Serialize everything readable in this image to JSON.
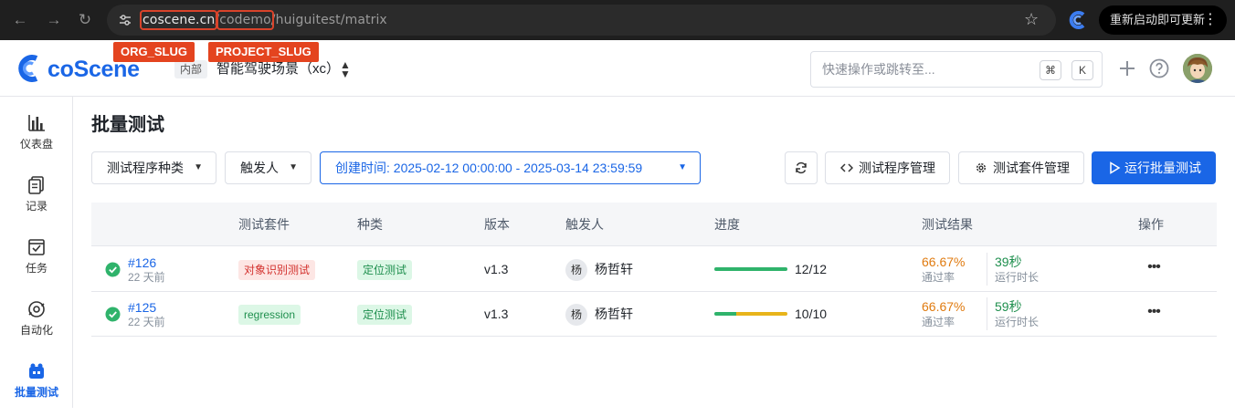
{
  "browser": {
    "url_host": "coscene.cn",
    "url_slash1": "/",
    "url_project": "codemo",
    "url_rest": "/huiguitest/matrix",
    "update_label": "重新启动即可更新",
    "annotations": {
      "org": "ORG_SLUG",
      "project": "PROJECT_SLUG"
    }
  },
  "header": {
    "brand": "coScene",
    "internal_tag": "内部",
    "project_name": "智能驾驶场景（xc）",
    "search_placeholder": "快速操作或跳转至...",
    "kbd_cmd": "⌘",
    "kbd_k": "K"
  },
  "sidebar": {
    "items": [
      {
        "label": "仪表盘",
        "icon": "chart-bar-icon"
      },
      {
        "label": "记录",
        "icon": "records-icon"
      },
      {
        "label": "任务",
        "icon": "task-icon"
      },
      {
        "label": "自动化",
        "icon": "automation-icon"
      },
      {
        "label": "批量测试",
        "icon": "batch-test-icon",
        "active": true
      }
    ]
  },
  "page": {
    "title": "批量测试",
    "filters": {
      "program_type": "测试程序种类",
      "trigger": "触发人",
      "date_range": "创建时间: 2025-02-12 00:00:00 - 2025-03-14 23:59:59"
    },
    "actions": {
      "program_manage": "测试程序管理",
      "suite_manage": "测试套件管理",
      "run": "运行批量测试"
    }
  },
  "table": {
    "columns": [
      "测试套件",
      "种类",
      "版本",
      "触发人",
      "进度",
      "测试结果",
      "操作"
    ],
    "rows": [
      {
        "id": "#126",
        "time": "22 天前",
        "suite": "对象识别测试",
        "suite_color": "red",
        "type": "定位测试",
        "version": "v1.3",
        "user_initial": "杨",
        "user": "杨哲轩",
        "progress": "12/12",
        "progress_segments": [
          {
            "color": "#2fb36b",
            "fraction": 1.0
          }
        ],
        "pass_rate": "66.67%",
        "pass_label": "通过率",
        "duration": "39秒",
        "duration_label": "运行时长"
      },
      {
        "id": "#125",
        "time": "22 天前",
        "suite": "regression",
        "suite_color": "green",
        "type": "定位测试",
        "version": "v1.3",
        "user_initial": "杨",
        "user": "杨哲轩",
        "progress": "10/10",
        "progress_segments": [
          {
            "color": "#2fb36b",
            "fraction": 0.3
          },
          {
            "color": "#e8b41a",
            "fraction": 0.7
          }
        ],
        "pass_rate": "66.67%",
        "pass_label": "通过率",
        "duration": "59秒",
        "duration_label": "运行时长"
      }
    ]
  },
  "colors": {
    "primary": "#1a66e6",
    "success": "#2fb36b",
    "warning": "#e8b41a",
    "annotation": "#e4441f"
  }
}
